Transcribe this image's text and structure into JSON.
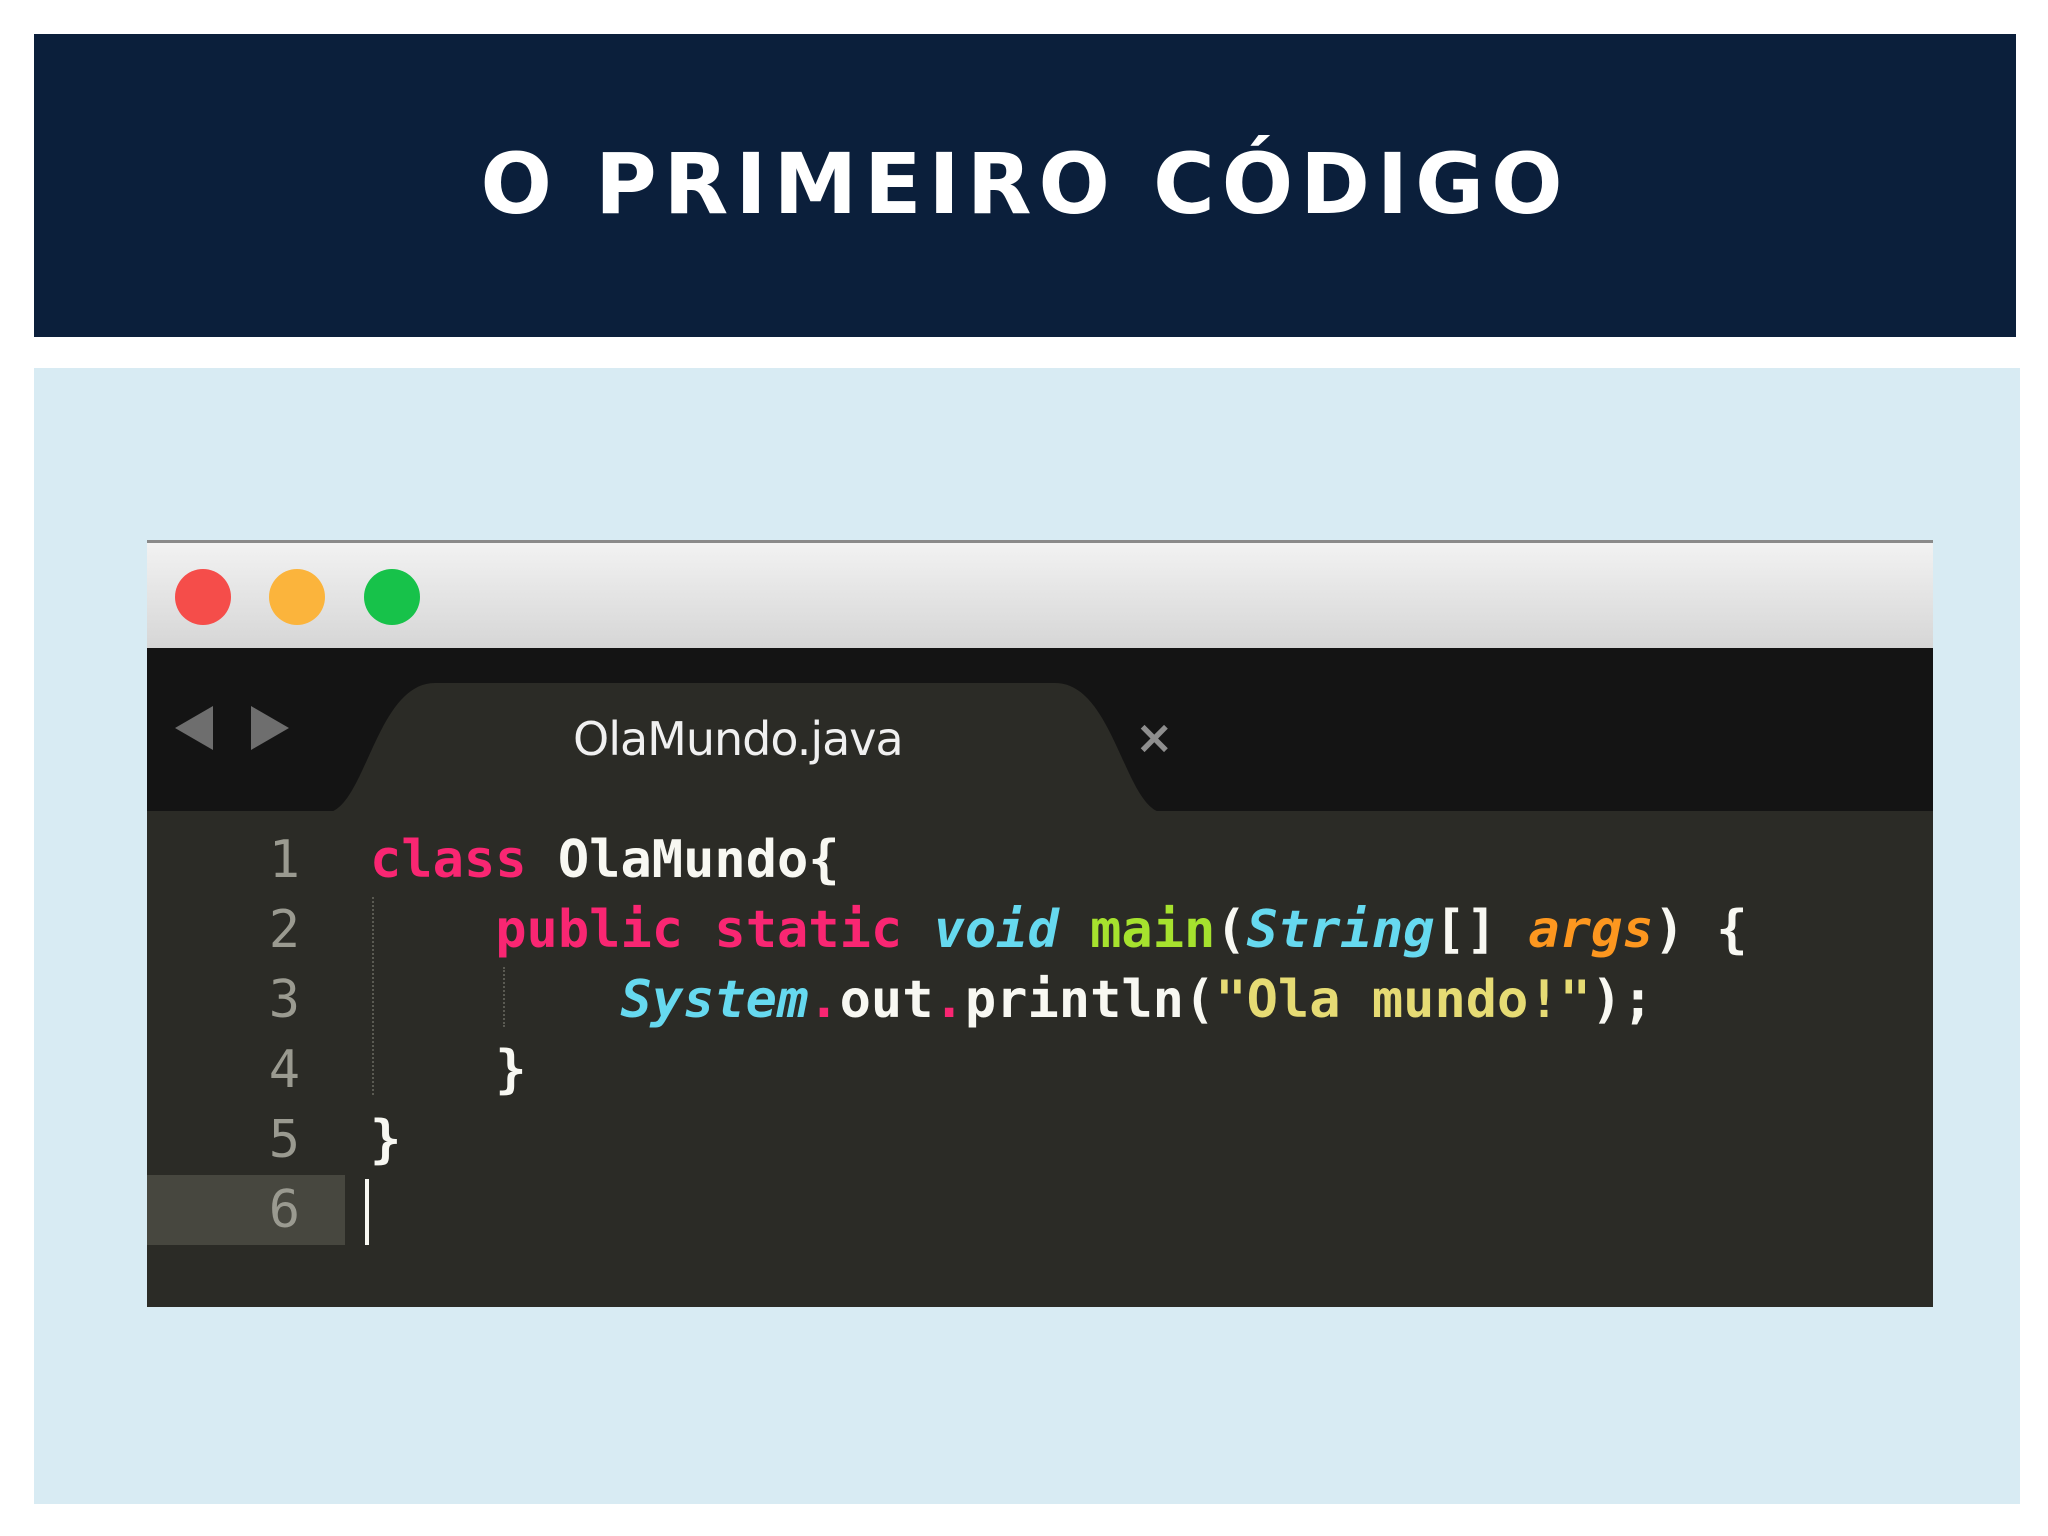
{
  "slide": {
    "title": "O PRIMEIRO CÓDIGO"
  },
  "window": {
    "buttons": [
      "close",
      "minimize",
      "zoom"
    ]
  },
  "tab": {
    "filename": "OlaMundo.java",
    "close_glyph": "×"
  },
  "editor": {
    "line_numbers": [
      "1",
      "2",
      "3",
      "4",
      "5",
      "6"
    ],
    "current_line": 6,
    "lines": [
      [
        {
          "t": "class",
          "c": "kw"
        },
        {
          "t": " OlaMundo{",
          "c": "plain"
        }
      ],
      [
        {
          "t": "    ",
          "c": "plain"
        },
        {
          "t": "public",
          "c": "kw"
        },
        {
          "t": " ",
          "c": "plain"
        },
        {
          "t": "static",
          "c": "kw"
        },
        {
          "t": " ",
          "c": "plain"
        },
        {
          "t": "void",
          "c": "ty"
        },
        {
          "t": " ",
          "c": "plain"
        },
        {
          "t": "main",
          "c": "fn"
        },
        {
          "t": "(",
          "c": "plain"
        },
        {
          "t": "String",
          "c": "ty"
        },
        {
          "t": "[] ",
          "c": "plain"
        },
        {
          "t": "args",
          "c": "arg"
        },
        {
          "t": ") {",
          "c": "plain"
        }
      ],
      [
        {
          "t": "        ",
          "c": "plain"
        },
        {
          "t": "System",
          "c": "ty"
        },
        {
          "t": ".",
          "c": "kw"
        },
        {
          "t": "out",
          "c": "plain"
        },
        {
          "t": ".",
          "c": "kw"
        },
        {
          "t": "println(",
          "c": "plain"
        },
        {
          "t": "\"Ola mundo!\"",
          "c": "str"
        },
        {
          "t": ");",
          "c": "plain"
        }
      ],
      [
        {
          "t": "    }",
          "c": "plain"
        }
      ],
      [
        {
          "t": "}",
          "c": "plain"
        }
      ],
      []
    ]
  },
  "colors": {
    "title_background": "#0b1f3b",
    "panel_background": "#d8ebf3",
    "editor_background": "#2b2b26",
    "keyword": "#f92672",
    "function": "#a6e22e",
    "type": "#66d9ef",
    "argument": "#fd971f",
    "string": "#e6db74"
  }
}
